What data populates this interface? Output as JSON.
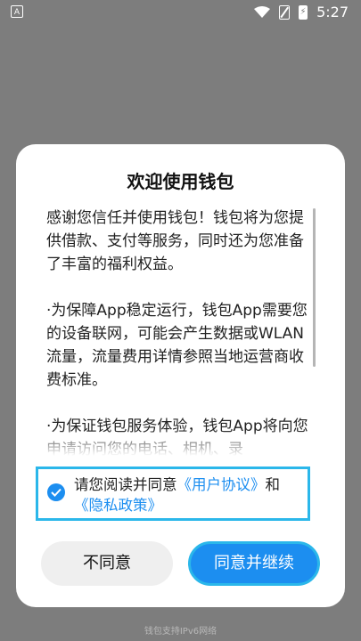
{
  "status_bar": {
    "left_badge": "A",
    "time": "5:27",
    "icons": [
      "app-notification-icon",
      "wifi-icon",
      "no-sim-icon",
      "battery-charging-icon"
    ]
  },
  "dialog": {
    "title": "欢迎使用钱包",
    "paragraphs": [
      "感谢您信任并使用钱包！钱包将为您提供借款、支付等服务，同时还为您准备了丰富的福利权益。",
      "·为保障App稳定运行，钱包App需要您的设备联网，可能会产生数据或WLAN流量，流量费用详情参照当地运营商收费标准。",
      "·为保证钱包服务体验，钱包App将向您申请访问您的电话、相机、录"
    ],
    "agreement": {
      "prefix": "请您阅读并同意",
      "user_agreement": "《用户协议》",
      "and": "和",
      "privacy_policy": "《隐私政策》"
    },
    "buttons": {
      "disagree": "不同意",
      "agree": "同意并继续"
    }
  },
  "footer": "钱包支持IPv6网络",
  "colors": {
    "accent": "#1c8ef0",
    "focus_ring": "#2bb7ea",
    "overlay": "#7d7d7d"
  }
}
